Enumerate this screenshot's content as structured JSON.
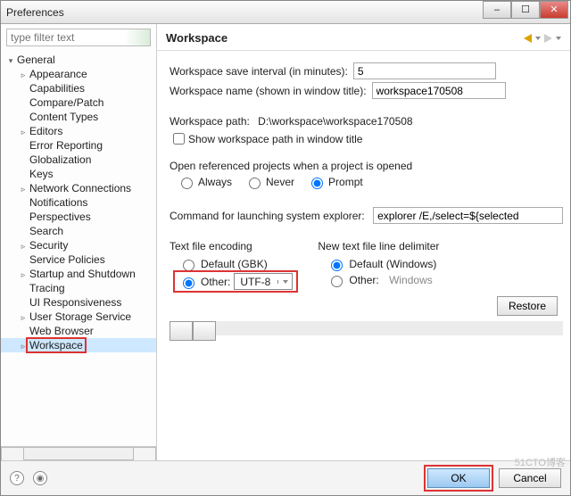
{
  "window": {
    "title": "Preferences"
  },
  "filter": {
    "placeholder": "type filter text"
  },
  "tree": {
    "root": "General",
    "items": [
      {
        "label": "Appearance",
        "expandable": true
      },
      {
        "label": "Capabilities",
        "expandable": false
      },
      {
        "label": "Compare/Patch",
        "expandable": false
      },
      {
        "label": "Content Types",
        "expandable": false
      },
      {
        "label": "Editors",
        "expandable": true
      },
      {
        "label": "Error Reporting",
        "expandable": false
      },
      {
        "label": "Globalization",
        "expandable": false
      },
      {
        "label": "Keys",
        "expandable": false
      },
      {
        "label": "Network Connections",
        "expandable": true
      },
      {
        "label": "Notifications",
        "expandable": false
      },
      {
        "label": "Perspectives",
        "expandable": false
      },
      {
        "label": "Search",
        "expandable": false
      },
      {
        "label": "Security",
        "expandable": true
      },
      {
        "label": "Service Policies",
        "expandable": false
      },
      {
        "label": "Startup and Shutdown",
        "expandable": true
      },
      {
        "label": "Tracing",
        "expandable": false
      },
      {
        "label": "UI Responsiveness",
        "expandable": false
      },
      {
        "label": "User Storage Service",
        "expandable": true
      },
      {
        "label": "Web Browser",
        "expandable": false
      },
      {
        "label": "Workspace",
        "expandable": true
      }
    ]
  },
  "page": {
    "heading": "Workspace",
    "saveIntervalLabel": "Workspace save interval (in minutes):",
    "saveIntervalValue": "5",
    "wsNameLabel": "Workspace name (shown in window title):",
    "wsNameValue": "workspace170508",
    "wsPathLabel": "Workspace path:",
    "wsPathValue": "D:\\workspace\\workspace170508",
    "showPathCheckbox": "Show workspace path in window title",
    "openRef": {
      "title": "Open referenced projects when a project is opened",
      "options": [
        "Always",
        "Never",
        "Prompt"
      ],
      "selected": "Prompt"
    },
    "explorerLabel": "Command for launching system explorer:",
    "explorerValue": "explorer /E,/select=${selected",
    "encoding": {
      "title": "Text file encoding",
      "defaultLabel": "Default (GBK)",
      "otherLabel": "Other:",
      "otherValue": "UTF-8",
      "selected": "other"
    },
    "delimiter": {
      "title": "New text file line delimiter",
      "defaultLabel": "Default (Windows)",
      "otherLabel": "Other:",
      "otherValue": "Windows",
      "selected": "default"
    },
    "restore": "Restore"
  },
  "footer": {
    "ok": "OK",
    "cancel": "Cancel"
  },
  "watermark": "51CTO博客"
}
